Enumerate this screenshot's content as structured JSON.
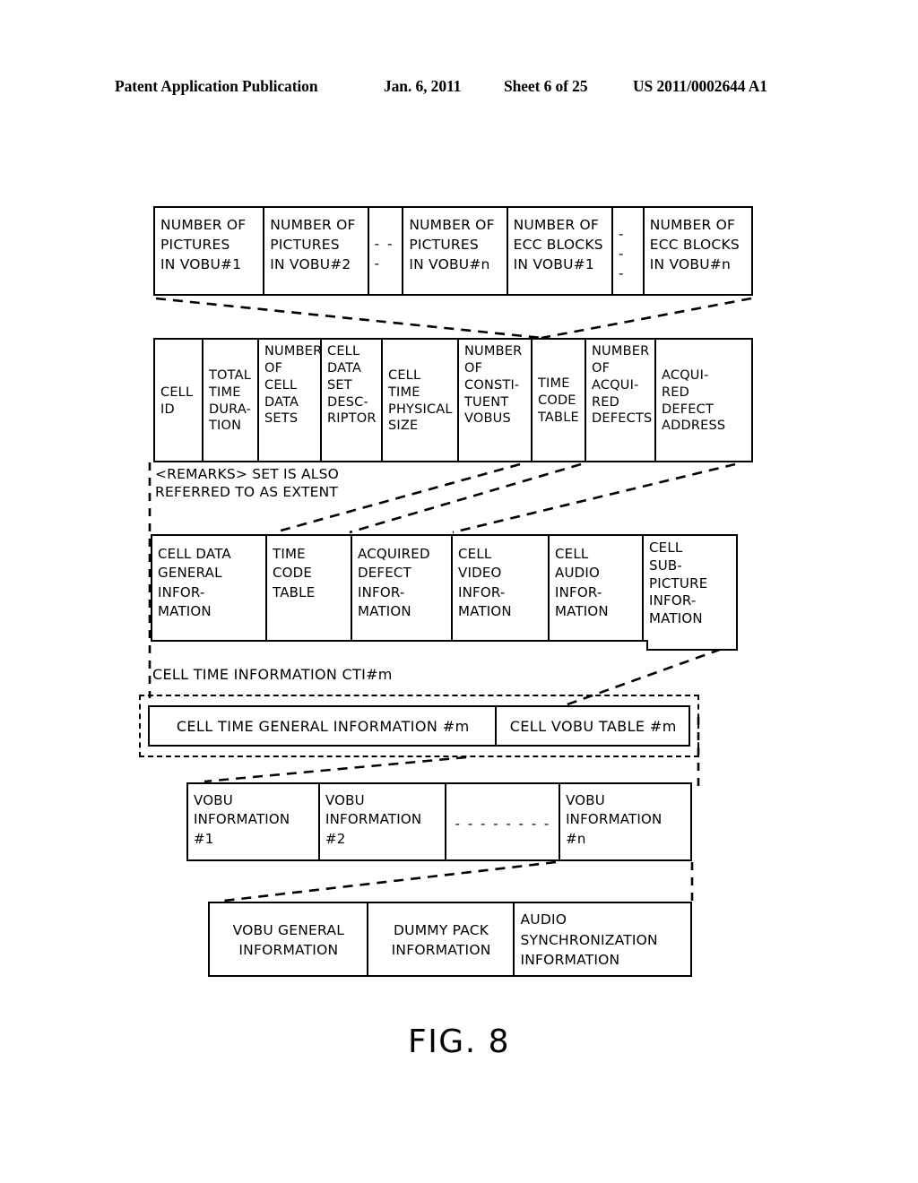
{
  "header": {
    "publication": "Patent Application Publication",
    "date": "Jan. 6, 2011",
    "sheet": "Sheet 6 of 25",
    "number": "US 2011/0002644 A1"
  },
  "figure": {
    "label": "FIG. 8"
  },
  "diagram": {
    "remarks": "<REMARKS> SET IS ALSO\nREFERRED TO AS EXTENT",
    "cti_label": "CELL TIME INFORMATION CTI#m",
    "row1": {
      "name": "vobu-picture-ecc-table",
      "cells": [
        "NUMBER OF\nPICTURES\nIN VOBU#1",
        "NUMBER OF\nPICTURES\nIN VOBU#2",
        "- - -",
        "NUMBER OF\nPICTURES\nIN VOBU#n",
        "NUMBER OF\nECC BLOCKS\nIN VOBU#1",
        "- - -",
        "NUMBER OF\nECC BLOCKS\nIN VOBU#n"
      ]
    },
    "row2": {
      "name": "cell-general-information-table",
      "cells": [
        "CELL\nID",
        "TOTAL\nTIME\nDURA-\nTION",
        "NUMBER\nOF\nCELL\nDATA\nSETS",
        "CELL\nDATA\nSET\nDESC-\nRIPTOR",
        "CELL\nTIME\nPHYSICAL\nSIZE",
        "NUMBER\nOF\nCONSTI-\nTUENT\nVOBUS",
        "TIME\nCODE\nTABLE",
        "NUMBER\nOF\nACQUI-\nRED\nDEFECTS",
        "ACQUI-\nRED\nDEFECT\nADDRESS"
      ]
    },
    "row3": {
      "name": "cell-data-set-table",
      "cells": [
        "CELL DATA\nGENERAL\nINFOR-\nMATION",
        "TIME\nCODE\nTABLE",
        "ACQUIRED\nDEFECT\nINFOR-\nMATION",
        "CELL\nVIDEO\nINFOR-\nMATION",
        "CELL\nAUDIO\nINFOR-\nMATION",
        "CELL\nSUB-\nPICTURE\nINFOR-\nMATION"
      ]
    },
    "row4": {
      "name": "cell-time-information-table",
      "cells": [
        "CELL TIME GENERAL INFORMATION #m",
        "CELL VOBU TABLE #m"
      ]
    },
    "row5": {
      "name": "vobu-information-table",
      "cells": [
        "VOBU\nINFORMATION\n#1",
        "VOBU\nINFORMATION\n#2",
        "- - - - - - - -",
        "VOBU\nINFORMATION\n#n"
      ]
    },
    "row6": {
      "name": "vobu-detail-table",
      "cells": [
        "VOBU GENERAL\nINFORMATION",
        "DUMMY PACK\nINFORMATION",
        "AUDIO\nSYNCHRONIZATION\nINFORMATION"
      ]
    }
  }
}
